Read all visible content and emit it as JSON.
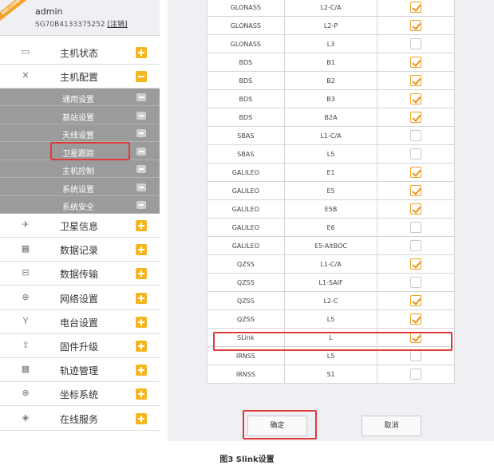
{
  "user": {
    "ribbon": "WELCOME",
    "name": "admin",
    "serial": "SG70B4133375252",
    "logout_label": "[注销]"
  },
  "nav_top": [
    {
      "label": "主机状态",
      "icon": "monitor-icon",
      "glyph": "▭",
      "state": "plus"
    },
    {
      "label": "主机配置",
      "icon": "tools-icon",
      "glyph": "✕",
      "state": "minus"
    }
  ],
  "submenu": [
    {
      "label": "通用设置"
    },
    {
      "label": "基站设置"
    },
    {
      "label": "天线设置"
    },
    {
      "label": "卫星跟踪",
      "highlighted": true
    },
    {
      "label": "主机控制"
    },
    {
      "label": "系统设置"
    },
    {
      "label": "系统安全"
    }
  ],
  "nav_bottom": [
    {
      "label": "卫星信息",
      "icon": "satellite-icon",
      "glyph": "✈"
    },
    {
      "label": "数据记录",
      "icon": "calendar-icon",
      "glyph": "▦"
    },
    {
      "label": "数据传输",
      "icon": "network-icon",
      "glyph": "⊟"
    },
    {
      "label": "网络设置",
      "icon": "globe-icon",
      "glyph": "⊕"
    },
    {
      "label": "电台设置",
      "icon": "radio-icon",
      "glyph": "Ｙ"
    },
    {
      "label": "固件升级",
      "icon": "upload-icon",
      "glyph": "⇪"
    },
    {
      "label": "轨迹管理",
      "icon": "calendar-icon",
      "glyph": "▦"
    },
    {
      "label": "坐标系统",
      "icon": "globe-icon",
      "glyph": "⊕"
    },
    {
      "label": "在线服务",
      "icon": "cube-icon",
      "glyph": "◈"
    }
  ],
  "signals": [
    {
      "system": "GLONASS",
      "signal": "L2-C/A",
      "checked": true
    },
    {
      "system": "GLONASS",
      "signal": "L2-P",
      "checked": true
    },
    {
      "system": "GLONASS",
      "signal": "L3",
      "checked": false
    },
    {
      "system": "BDS",
      "signal": "B1",
      "checked": true
    },
    {
      "system": "BDS",
      "signal": "B2",
      "checked": true
    },
    {
      "system": "BDS",
      "signal": "B3",
      "checked": true
    },
    {
      "system": "BDS",
      "signal": "B2A",
      "checked": true
    },
    {
      "system": "SBAS",
      "signal": "L1-C/A",
      "checked": false
    },
    {
      "system": "SBAS",
      "signal": "L5",
      "checked": false
    },
    {
      "system": "GALILEO",
      "signal": "E1",
      "checked": true
    },
    {
      "system": "GALILEO",
      "signal": "E5",
      "checked": true
    },
    {
      "system": "GALILEO",
      "signal": "E5B",
      "checked": true
    },
    {
      "system": "GALILEO",
      "signal": "E6",
      "checked": false
    },
    {
      "system": "GALILEO",
      "signal": "E5-AltBOC",
      "checked": false
    },
    {
      "system": "QZSS",
      "signal": "L1-C/A",
      "checked": true
    },
    {
      "system": "QZSS",
      "signal": "L1-SAIF",
      "checked": false
    },
    {
      "system": "QZSS",
      "signal": "L2-C",
      "checked": true
    },
    {
      "system": "QZSS",
      "signal": "L5",
      "checked": true
    },
    {
      "system": "SLink",
      "signal": "L",
      "checked": true,
      "highlighted": true
    },
    {
      "system": "IRNSS",
      "signal": "L5",
      "checked": false
    },
    {
      "system": "IRNSS",
      "signal": "S1",
      "checked": false
    }
  ],
  "buttons": {
    "ok": "确定",
    "cancel": "取消"
  },
  "caption": "图3 Slink设置",
  "colors": {
    "accent": "#f5b51f",
    "highlight": "#e03a3a",
    "submenu_bg": "#9b9b9b"
  }
}
